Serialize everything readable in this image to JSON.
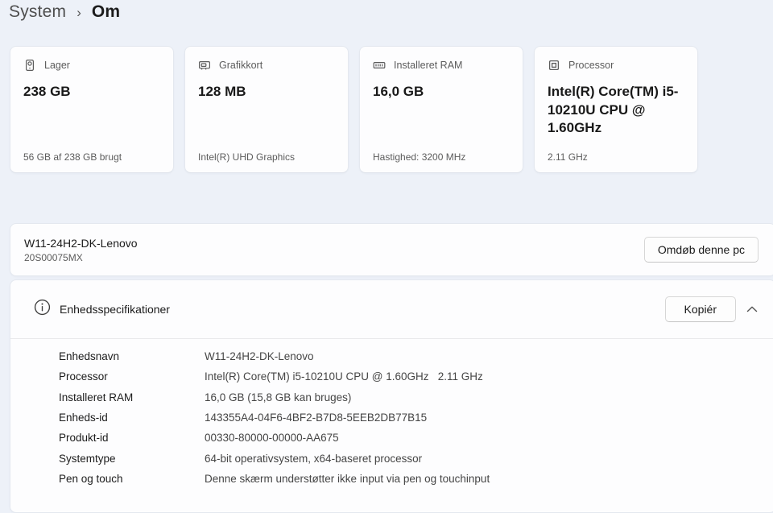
{
  "breadcrumb": {
    "parent": "System",
    "separator": "›",
    "current": "Om"
  },
  "cards": [
    {
      "icon": "storage-icon",
      "title": "Lager",
      "value": "238 GB",
      "footer": "56 GB af 238 GB brugt"
    },
    {
      "icon": "gpu-icon",
      "title": "Grafikkort",
      "value": "128 MB",
      "footer": "Intel(R) UHD Graphics"
    },
    {
      "icon": "ram-icon",
      "title": "Installeret RAM",
      "value": "16,0 GB",
      "footer": "Hastighed: 3200 MHz"
    },
    {
      "icon": "cpu-icon",
      "title": "Processor",
      "value": "Intel(R) Core(TM) i5-10210U CPU @ 1.60GHz",
      "footer": "2.11 GHz"
    }
  ],
  "device": {
    "name": "W11-24H2-DK-Lenovo",
    "model": "20S00075MX",
    "rename_button": "Omdøb denne pc"
  },
  "specs": {
    "title": "Enhedsspecifikationer",
    "copy_button": "Kopiér",
    "expanded": true,
    "rows": [
      {
        "label": "Enhedsnavn",
        "value": "W11-24H2-DK-Lenovo"
      },
      {
        "label": "Processor",
        "value": "Intel(R) Core(TM) i5-10210U CPU @ 1.60GHz   2.11 GHz"
      },
      {
        "label": "Installeret RAM",
        "value": "16,0 GB (15,8 GB kan bruges)"
      },
      {
        "label": "Enheds-id",
        "value": "143355A4-04F6-4BF2-B7D8-5EEB2DB77B15"
      },
      {
        "label": "Produkt-id",
        "value": "00330-80000-00000-AA675"
      },
      {
        "label": "Systemtype",
        "value": "64-bit operativsystem, x64-baseret processor"
      },
      {
        "label": "Pen og touch",
        "value": "Denne skærm understøtter ikke input via pen og touchinput"
      }
    ]
  },
  "colors": {
    "page_background": "#edf1f8",
    "card_background": "#fdfdfe",
    "card_border": "#e4e8ef",
    "text_primary": "#1b1b1b",
    "text_secondary": "#5c5c5c"
  }
}
